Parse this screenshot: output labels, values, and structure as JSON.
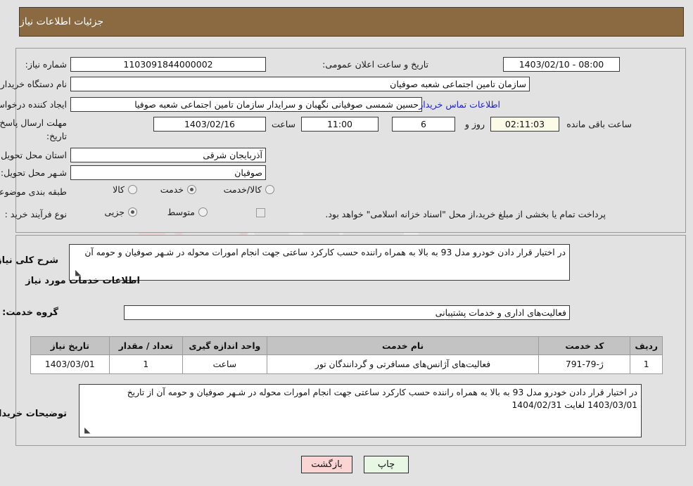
{
  "header": {
    "title": "جزئیات اطلاعات نیاز"
  },
  "fields": {
    "need_number_label": "شماره نیاز:",
    "need_number_value": "1103091844000002",
    "announce_label": "تاریخ و ساعت اعلان عمومی:",
    "announce_value": "08:00 - 1403/02/10",
    "buyer_org_label": "نام دستگاه خریدار:",
    "buyer_org_value": "سازمان تامین اجتماعی شعبه صوفیان",
    "requester_label": "ایجاد کننده درخواست:",
    "requester_value": "حسین شمسی صوفیانی نگهبان و سرایدار سازمان تامین اجتماعی شعبه صوفیا",
    "contact_link": "اطلاعات تماس خریدار",
    "deadline_label_line1": "مهلت ارسال پاسخ: تا",
    "deadline_label_line2": "تاریخ:",
    "deadline_date": "1403/02/16",
    "time_label": "ساعت",
    "deadline_time": "11:00",
    "days_value": "6",
    "days_label": "روز و",
    "countdown_value": "02:11:03",
    "remaining_label": "ساعت باقی مانده",
    "province_label": "استان محل تحویل:",
    "province_value": "آذربایجان شرقی",
    "city_label": "شـهر محل تحویل:",
    "city_value": "صوفیان",
    "category_label": "طبقه بندی موضوعی:",
    "process_label": "نوع فرآیند خرید :",
    "treasury_note": "پرداخت تمام یا بخشی از مبلغ خرید،از محل \"اسناد خزانه اسلامی\" خواهد بود."
  },
  "category_options": [
    {
      "label": "کالا",
      "selected": false
    },
    {
      "label": "خدمت",
      "selected": true
    },
    {
      "label": "کالا/خدمت",
      "selected": false
    }
  ],
  "process_options": [
    {
      "label": "جزیی",
      "selected": true
    },
    {
      "label": "متوسط",
      "selected": false
    }
  ],
  "description": {
    "label": "شرح کلی نیاز:",
    "value": "در اختیار قرار دادن خودرو مدل 93 به بالا به همراه راننده حسب کارکرد ساعتی جهت انجام امورات محوله در شـهر صوفیان و حومه آن"
  },
  "services_section": {
    "heading": "اطلاعات خدمات مورد نیاز",
    "group_label": "گروه خدمت:",
    "group_value": "فعالیت‌های اداری و خدمات پشتیبانی"
  },
  "table": {
    "columns": [
      "ردیف",
      "کد خدمت",
      "نام خدمت",
      "واحد اندازه گیری",
      "تعداد / مقدار",
      "تاریخ نیاز"
    ],
    "rows": [
      {
        "row_no": "1",
        "service_code": "ژ-79-791",
        "service_name": "فعالیت‌های آژانس‌های مسافرتی و گردانندگان تور",
        "unit": "ساعت",
        "quantity": "1",
        "need_date": "1403/03/01"
      }
    ]
  },
  "buyer_notes": {
    "label": "توضیحات خریدار:",
    "value": "در اختیار قرار دادن خودرو مدل 93 به بالا به همراه راننده حسب کارکرد ساعتی جهت انجام امورات محوله در شـهر صوفیان و حومه آن از تاریخ 1403/03/01 لغایت 1404/02/31"
  },
  "buttons": {
    "print": "چاپ",
    "back": "بازگشت"
  },
  "colors": {
    "header_bar": "#8b6a41",
    "page_bg": "#e2e2e2",
    "link": "#2020d0",
    "table_header": "#c3c3c3",
    "countdown_bg": "#fbfbe8",
    "print_btn": "#e8f6e4",
    "back_btn": "#fbd4d4"
  }
}
